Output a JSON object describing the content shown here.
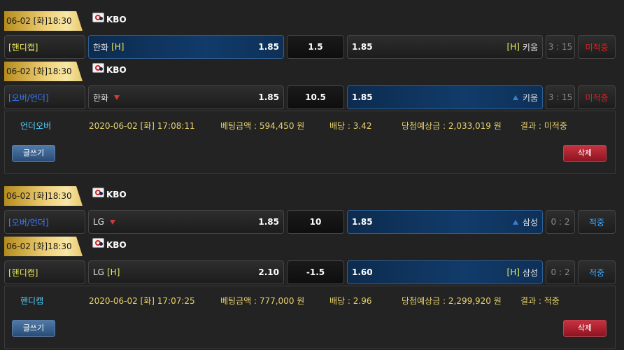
{
  "slips": [
    {
      "bets": [
        {
          "date": "06-02 [화]18:30",
          "league": "KBO",
          "type": "[핸디캡]",
          "home_team": "한화",
          "home_tag": "[H]",
          "home_odds": "1.85",
          "line": "1.5",
          "away_odds": "1.85",
          "away_tag": "[H]",
          "away_team": "키움",
          "score": "3 : 15",
          "result": "미적중"
        },
        {
          "date": "06-02 [화]18:30",
          "league": "KBO",
          "type": "[오버/언더]",
          "home_team": "한화",
          "home_odds": "1.85",
          "line": "10.5",
          "away_odds": "1.85",
          "away_team": "키움",
          "score": "3 : 15",
          "result": "미적중"
        }
      ],
      "summary": {
        "type": "언더오버",
        "datetime": "2020-06-02 [화] 17:08:11",
        "amount": "베팅금액 : 594,450 원",
        "rate": "배당 : 3.42",
        "expected": "당첨예상금 : 2,033,019 원",
        "result": "결과 : 미적중"
      }
    },
    {
      "bets": [
        {
          "date": "06-02 [화]18:30",
          "league": "KBO",
          "type": "[오버/언더]",
          "home_team": "LG",
          "home_odds": "1.85",
          "line": "10",
          "away_odds": "1.85",
          "away_team": "삼성",
          "score": "0 : 2",
          "result": "적중"
        },
        {
          "date": "06-02 [화]18:30",
          "league": "KBO",
          "type": "[핸디캡]",
          "home_team": "LG",
          "home_tag": "[H]",
          "home_odds": "2.10",
          "line": "-1.5",
          "away_odds": "1.60",
          "away_tag": "[H]",
          "away_team": "삼성",
          "score": "0 : 2",
          "result": "적중"
        }
      ],
      "summary": {
        "type": "핸디캡",
        "datetime": "2020-06-02 [화] 17:07:25",
        "amount": "베팅금액 : 777,000 원",
        "rate": "배당 : 2.96",
        "expected": "당첨예상금 : 2,299,920 원",
        "result": "결과 : 적중"
      }
    }
  ],
  "buttons": {
    "write_label": "글쓰기",
    "delete_label": "삭제"
  },
  "colors": {
    "gold_tab": "#f0d27a",
    "selected_blue": "#113b6a",
    "miss_red": "#e02020",
    "hit_blue": "#3aa7ff",
    "handicap_yellow": "#e8e85a",
    "overunder_blue": "#3a7cff"
  },
  "icons": {
    "league": "kbo-league-icon",
    "over": "arrow-up-icon",
    "under": "arrow-down-icon"
  }
}
